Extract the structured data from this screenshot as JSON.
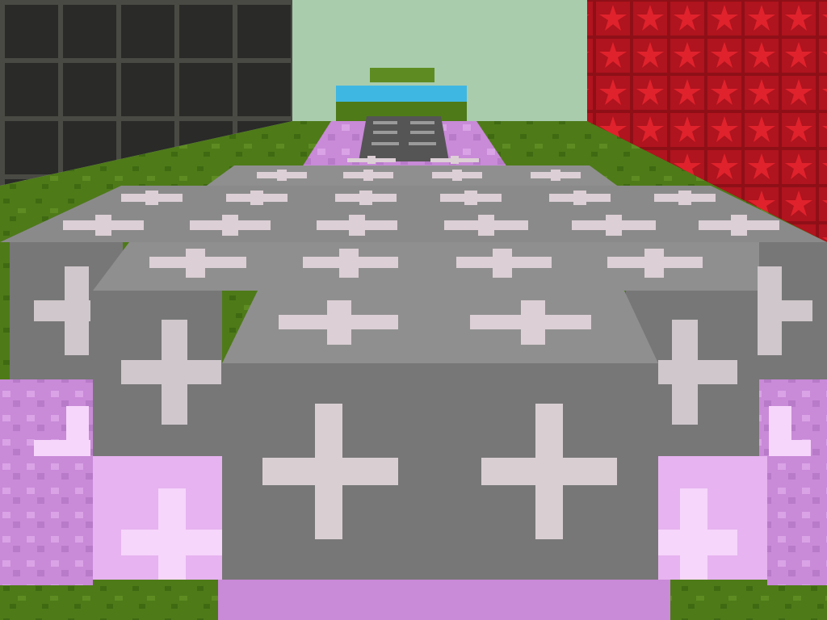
{
  "scene": {
    "view": "first-person",
    "game_style": "voxel block world",
    "hud_text": [],
    "blocks": {
      "left_wall": "dark-grid-stone",
      "right_wall": "red-star-blocks",
      "floor": "grass",
      "path_near": "gray-cross-blocks",
      "path_trim": "pink-crystal-blocks",
      "path_far": "dark-gray-cross-blocks",
      "distant_pool": "water",
      "distant_island": "grass-platform"
    }
  },
  "palette": {
    "sky": "#a9ccad",
    "grass": "#4e7a18",
    "grass_dark": "#3f6a12",
    "dark_wall": "#2a2a28",
    "dark_wall_line": "#4a4a44",
    "red_wall": "#b0141e",
    "red_star": "#e0222c",
    "stone_top": "#8f8f8f",
    "stone_front": "#777777",
    "stone_side": "#6b6b6b",
    "cross": "#d9cfd3",
    "pink": "#c98ad8",
    "pink_light": "#e7b3f0",
    "pink_cross": "#f6d6fb",
    "water": "#3fb7e3"
  }
}
